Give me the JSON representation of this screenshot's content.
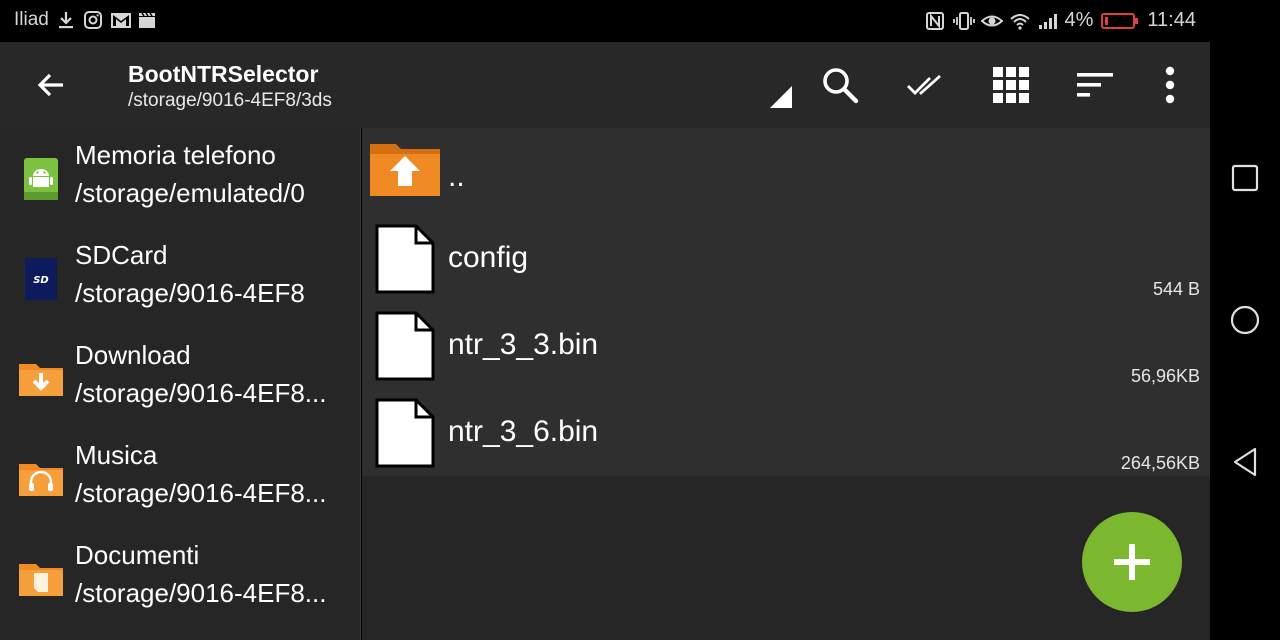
{
  "status_bar": {
    "carrier": "Iliad",
    "battery_percent": "4%",
    "time": "11:44",
    "icons_left": [
      "download-icon",
      "instagram-icon",
      "gmail-icon",
      "clapper-icon"
    ],
    "icons_right": [
      "nfc-icon",
      "vibrate-icon",
      "eye-icon",
      "wifi-icon",
      "signal-icon",
      "battery-icon"
    ]
  },
  "app_bar": {
    "title": "BootNTRSelector",
    "subtitle": "/storage/9016-4EF8/3ds",
    "actions": [
      "search-icon",
      "select-all-icon",
      "grid-view-icon",
      "sort-icon",
      "more-icon"
    ]
  },
  "sidebar": {
    "items": [
      {
        "name": "Memoria telefono",
        "path": "/storage/emulated/0",
        "icon": "android-storage-icon"
      },
      {
        "name": "SDCard",
        "path": "/storage/9016-4EF8",
        "icon": "sdcard-icon"
      },
      {
        "name": "Download",
        "path": "/storage/9016-4EF8...",
        "icon": "download-folder-icon"
      },
      {
        "name": "Musica",
        "path": "/storage/9016-4EF8...",
        "icon": "music-folder-icon"
      },
      {
        "name": "Documenti",
        "path": "/storage/9016-4EF8...",
        "icon": "documents-folder-icon"
      }
    ]
  },
  "files": [
    {
      "name": "..",
      "size": "",
      "icon": "parent-folder-icon"
    },
    {
      "name": "config",
      "size": "544 B",
      "icon": "file-icon"
    },
    {
      "name": "ntr_3_3.bin",
      "size": "56,96KB",
      "icon": "file-icon"
    },
    {
      "name": "ntr_3_6.bin",
      "size": "264,56KB",
      "icon": "file-icon"
    }
  ],
  "colors": {
    "accent_green": "#7cb82f",
    "folder_orange": "#f08a24",
    "app_bar": "#282828",
    "background": "#262626"
  }
}
